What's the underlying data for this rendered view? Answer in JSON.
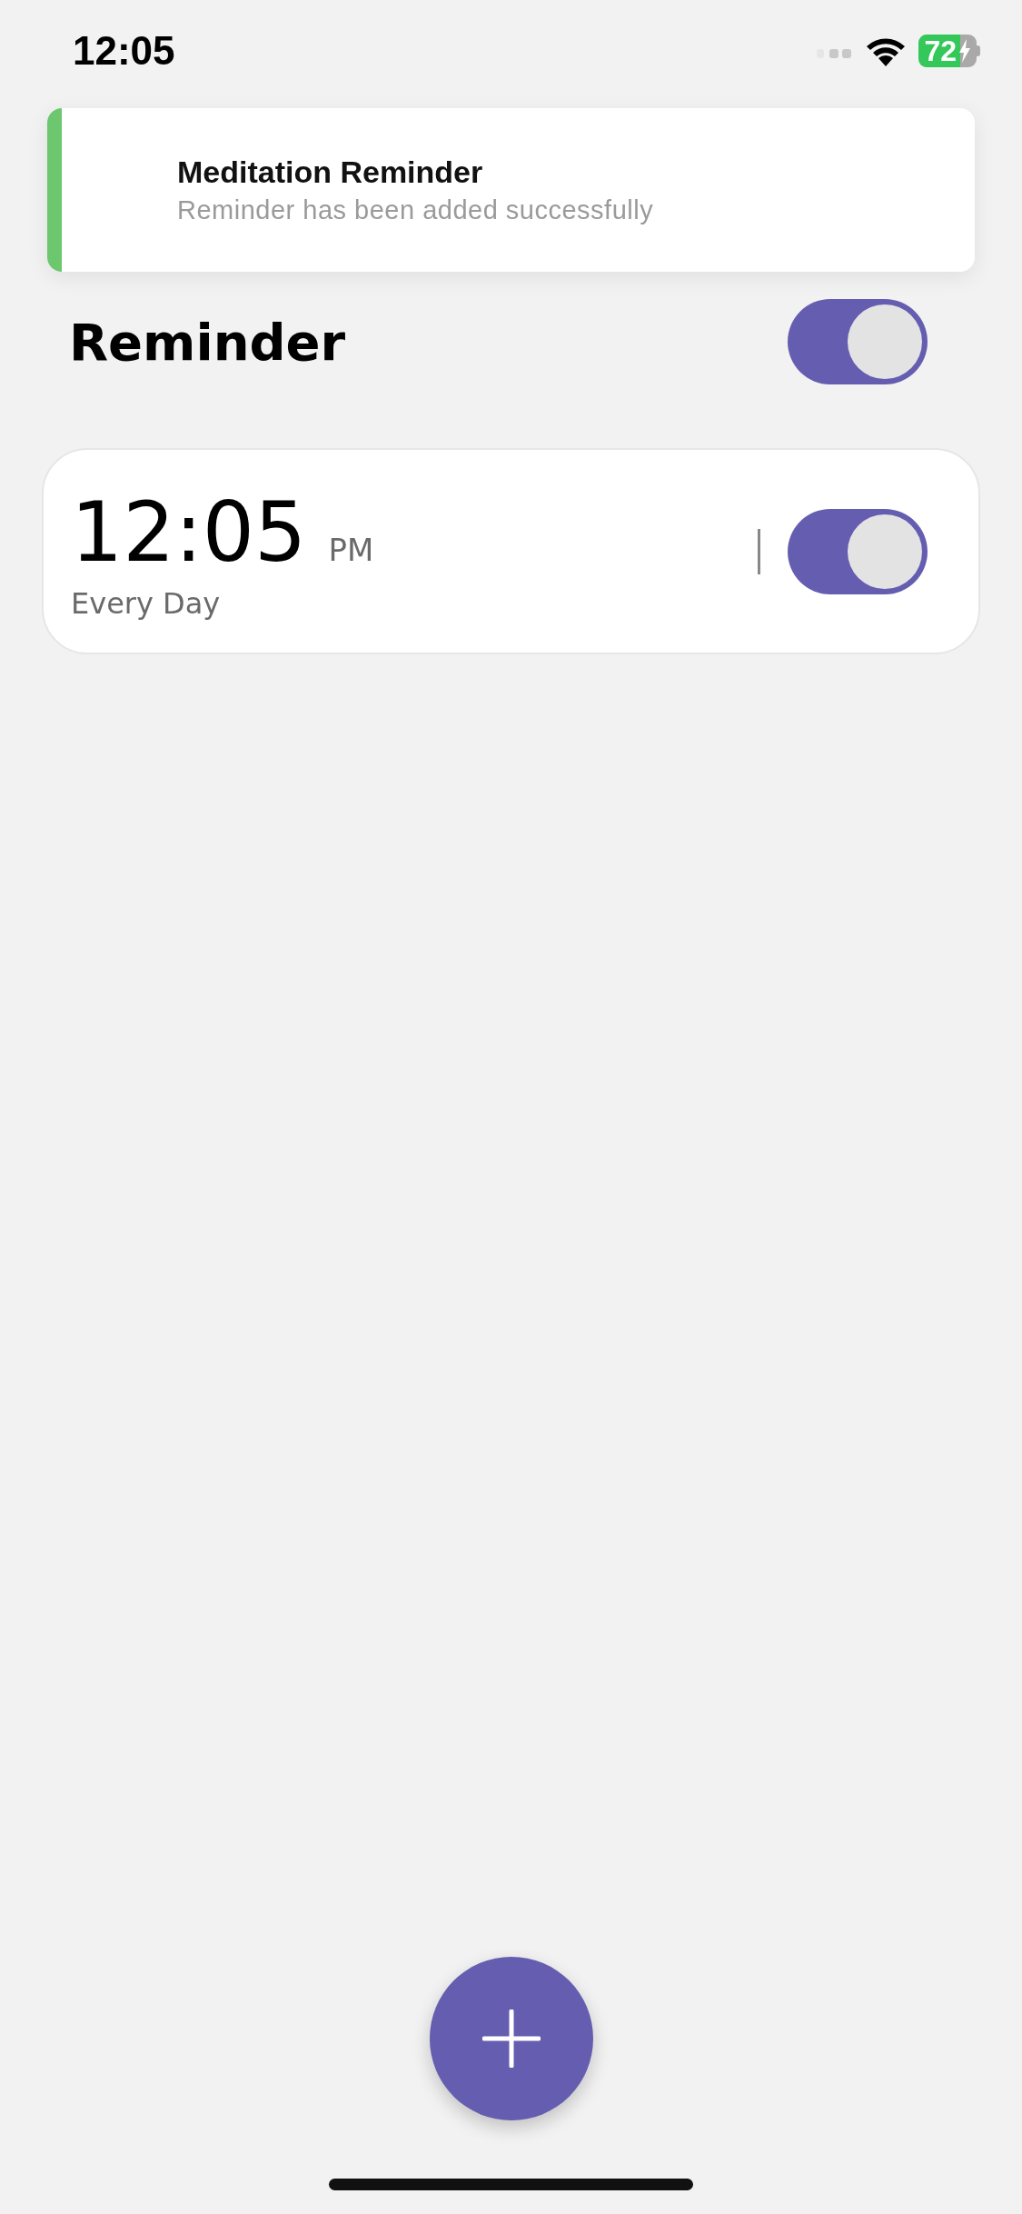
{
  "status_bar": {
    "time": "12:05",
    "battery": "72"
  },
  "toast": {
    "title": "Meditation Reminder",
    "message": "Reminder has been added successfully",
    "color": "#6cc76f"
  },
  "header": {
    "title": "Reminder",
    "on": true
  },
  "reminders": [
    {
      "time": "12:05",
      "period": "PM",
      "repeat": "Every Day",
      "on": true
    }
  ]
}
